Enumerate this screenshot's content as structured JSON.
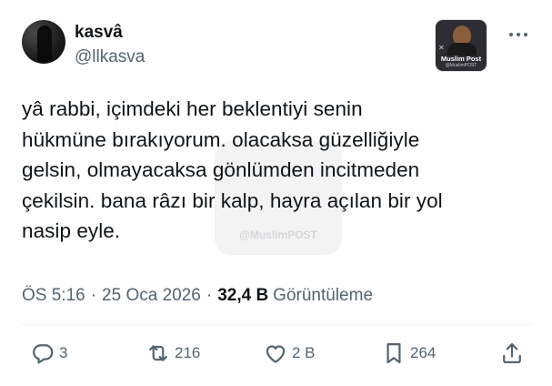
{
  "author": {
    "name": "kasvâ",
    "handle": "@llkasva"
  },
  "badge": {
    "title": "Muslim Post",
    "subtitle": "@MuslimPOST"
  },
  "tweet": {
    "text": "yâ rabbi, içimdeki her beklentiyi senin\nhükmüne bırakıyorum. olacaksa güzelliğiyle\ngelsin, olmayacaksa gönlümden incitmeden\nçekilsin. bana râzı bir kalp, hayra açılan bir yol\nnasip eyle."
  },
  "watermark": {
    "text": "@MuslimPOST"
  },
  "meta": {
    "time": "ÖS 5:16",
    "separator": "·",
    "date": "25 Oca 2026",
    "views_count": "32,4 B",
    "views_label": "Görüntüleme"
  },
  "actions": {
    "replies": "3",
    "reposts": "216",
    "likes": "2 B",
    "bookmarks": "264"
  },
  "icons": {
    "reply": "reply-icon",
    "repost": "repost-icon",
    "like": "heart-icon",
    "bookmark": "bookmark-icon",
    "share": "share-icon",
    "more": "more-icon"
  },
  "colors": {
    "text": "#0f1419",
    "secondary": "#536471",
    "divider": "#eff3f4"
  }
}
